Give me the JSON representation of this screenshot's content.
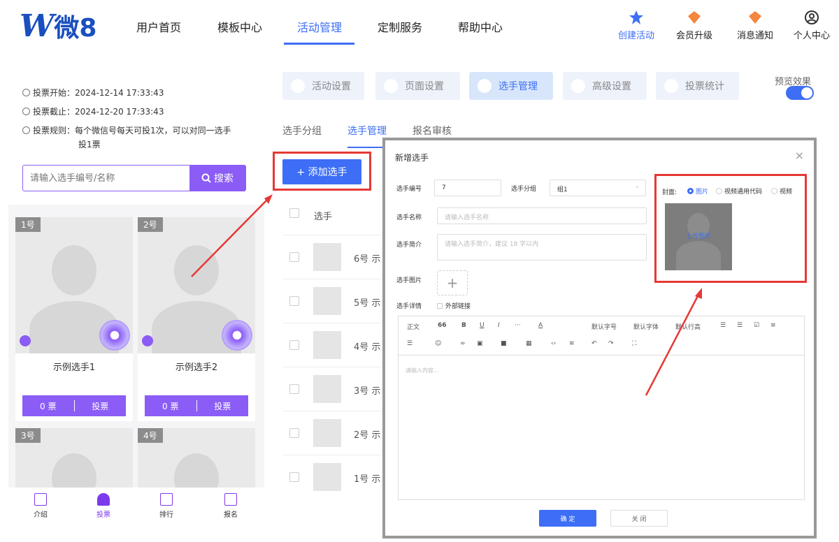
{
  "header": {
    "logo_w": "W",
    "logo_text": "微8",
    "nav": [
      "用户首页",
      "模板中心",
      "活动管理",
      "定制服务",
      "帮助中心"
    ],
    "icons": [
      {
        "label": "创建活动",
        "icon": "star-icon"
      },
      {
        "label": "会员升级",
        "icon": "vip-icon"
      },
      {
        "label": "消息通知",
        "icon": "bell-icon"
      },
      {
        "label": "个人中心",
        "icon": "user-icon"
      }
    ]
  },
  "preview": {
    "start": "投票开始：2024-12-14 17:33:43",
    "end": "投票截止：2024-12-20 17:33:43",
    "rule_1": "投票规则：每个微信号每天可投1次，可以对同一选手",
    "rule_2": "投1票",
    "search_placeholder": "请输入选手编号/名称",
    "search_label": "搜索",
    "cards": [
      {
        "num": "1号",
        "name": "示例选手1",
        "votes": "0 票",
        "vote_btn": "投票"
      },
      {
        "num": "2号",
        "name": "示例选手2",
        "votes": "0 票",
        "vote_btn": "投票"
      },
      {
        "num": "3号"
      },
      {
        "num": "4号"
      }
    ],
    "tabs": [
      "介绍",
      "投票",
      "排行",
      "报名"
    ]
  },
  "admin": {
    "top_tabs": [
      "活动设置",
      "页面设置",
      "选手管理",
      "高级设置",
      "投票统计"
    ],
    "preview_label": "预览效果",
    "sub_tabs": [
      "选手分组",
      "选手管理",
      "报名审核"
    ],
    "add_button": "+ 添加选手",
    "col_header": "选手",
    "rows": [
      {
        "num": "6号",
        "name_start": "示"
      },
      {
        "num": "5号",
        "name_start": "示"
      },
      {
        "num": "4号",
        "name_start": "示"
      },
      {
        "num": "3号",
        "name_start": "示"
      },
      {
        "num": "2号",
        "name_start": "示"
      },
      {
        "num": "1号",
        "name_start": "示"
      }
    ]
  },
  "modal": {
    "title": "新增选手",
    "close": "×",
    "id_label": "选手编号",
    "id_value": "7",
    "group_label": "选手分组",
    "group_value": "组1",
    "name_label": "选手名称",
    "name_placeholder": "请输入选手名称",
    "intro_label": "选手简介",
    "intro_placeholder": "请输入选手简介，建议 18 字以内",
    "image_label": "选手图片",
    "detail_label": "选手详情",
    "external_link": "外部链接",
    "cover_label": "封面:",
    "cover_options": [
      "图片",
      "视频通用代码",
      "视频"
    ],
    "upload_text": "上传图片",
    "toolbar": [
      "正文",
      "66",
      "B",
      "U",
      "I",
      "···",
      "A",
      "默认字号",
      "默认字体",
      "默认行高"
    ],
    "editor_placeholder": "请输入内容...",
    "ok": "确 定",
    "cancel": "关 闭"
  },
  "colors": {
    "accent": "#3d6ef5",
    "purple": "#8b5cf6",
    "highlight": "#e53935"
  }
}
